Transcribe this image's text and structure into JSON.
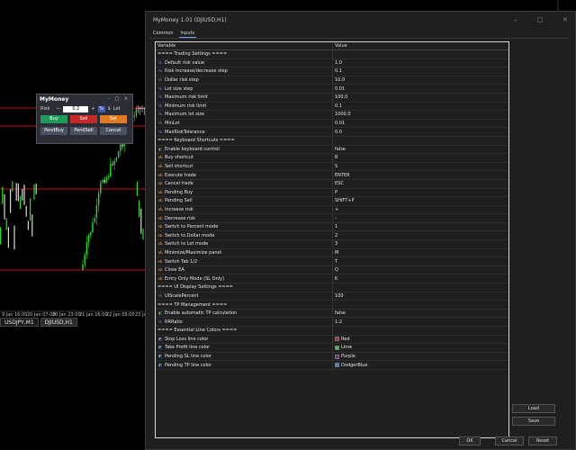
{
  "chart": {
    "x_labels": [
      "9 Jan 16:00",
      "20 Jan 07:00",
      "20 Jan 23:00",
      "21 Jan 16:00",
      "22 Jan 09:00",
      "23 Jan"
    ],
    "symbol_tabs": [
      "USDJPY,M1",
      "DJIUSD,H1"
    ]
  },
  "panel": {
    "title": "MyMoney",
    "controls": "– □ ×",
    "risk_label": "Risk",
    "risk_minus": "—",
    "risk_value": "0.2",
    "risk_plus": "+",
    "pct_btn": "%",
    "dollar_btn": "$",
    "lot_btn": "Lot",
    "buy": "Buy",
    "sell": "Sell",
    "set": "Set",
    "pend_buy": "PendBuy",
    "pend_sell": "PendSell",
    "cancel": "Cancel"
  },
  "dialog": {
    "title": "MyMoney 1.01 (DJIUSD,H1)",
    "tabs": [
      "Common",
      "Inputs"
    ],
    "col_variable": "Variable",
    "col_value": "Value",
    "rows": [
      {
        "type": "section",
        "label": "==== Trading Settings ===="
      },
      {
        "type": "num",
        "label": "Default risk value",
        "value": "1.0"
      },
      {
        "type": "num",
        "label": "Risk increase/decrease step",
        "value": "0.1"
      },
      {
        "type": "num",
        "label": "Dollar risk step",
        "value": "10.0"
      },
      {
        "type": "num",
        "label": "Lot size step",
        "value": "0.01"
      },
      {
        "type": "num",
        "label": "Maximum risk limit",
        "value": "100.0"
      },
      {
        "type": "num",
        "label": "Minimum risk limit",
        "value": "0.1"
      },
      {
        "type": "num",
        "label": "Maximum lot size",
        "value": "1000.0"
      },
      {
        "type": "num",
        "label": "MinLot",
        "value": "0.01"
      },
      {
        "type": "num",
        "label": "MaxRiskTolerance",
        "value": "0.0"
      },
      {
        "type": "section",
        "label": "==== Keyboard Shortcuts ===="
      },
      {
        "type": "tog",
        "label": "Enable keyboard control",
        "value": "false"
      },
      {
        "type": "ab",
        "label": "Buy shortcut",
        "value": "B"
      },
      {
        "type": "ab",
        "label": "Sell shortcut",
        "value": "S"
      },
      {
        "type": "ab",
        "label": "Execute trade",
        "value": "ENTER"
      },
      {
        "type": "ab",
        "label": "Cancel trade",
        "value": "ESC"
      },
      {
        "type": "ab",
        "label": "Pending Buy",
        "value": "P"
      },
      {
        "type": "ab",
        "label": "Pending Sell",
        "value": "SHIFT+P"
      },
      {
        "type": "ab",
        "label": "Increase risk",
        "value": "+"
      },
      {
        "type": "ab",
        "label": "Decrease risk",
        "value": "-"
      },
      {
        "type": "ab",
        "label": "Switch to Percent mode",
        "value": "1"
      },
      {
        "type": "ab",
        "label": "Switch to Dollar mode",
        "value": "2"
      },
      {
        "type": "ab",
        "label": "Switch to Lot mode",
        "value": "3"
      },
      {
        "type": "ab",
        "label": "Minimize/Maximize panel",
        "value": "M"
      },
      {
        "type": "ab",
        "label": "Switch Tab 1/2",
        "value": "T"
      },
      {
        "type": "ab",
        "label": "Close EA",
        "value": "Q"
      },
      {
        "type": "ab",
        "label": "Entry Only Mode (SL Only)",
        "value": "K"
      },
      {
        "type": "section",
        "label": "==== UI Display Settings ===="
      },
      {
        "type": "num",
        "label": "UIScalePercent",
        "value": "100"
      },
      {
        "type": "section",
        "label": "==== TP Management ===="
      },
      {
        "type": "tog",
        "label": "Enable automatic TP calculation",
        "value": "false"
      },
      {
        "type": "num",
        "label": "RRRatio",
        "value": "1:2"
      },
      {
        "type": "section",
        "label": "==== Essential Line Colors ===="
      },
      {
        "type": "color",
        "label": "Stop Loss line color",
        "value": "Red",
        "color": "#e01b1b"
      },
      {
        "type": "color",
        "label": "Take Profit line color",
        "value": "Lime",
        "color": "#22e022"
      },
      {
        "type": "color",
        "label": "Pending SL line color",
        "value": "Purple",
        "color": "#8a1a8a"
      },
      {
        "type": "color",
        "label": "Pending TP line color",
        "value": "DodgerBlue",
        "color": "#1e90ff"
      }
    ],
    "load": "Load",
    "save": "Save",
    "ok": "OK",
    "cancel": "Cancel",
    "reset": "Reset"
  }
}
